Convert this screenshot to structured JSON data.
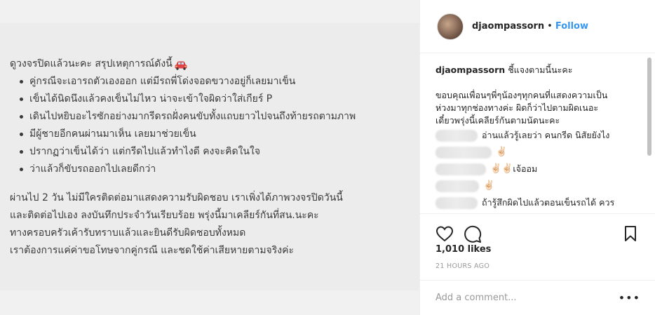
{
  "post_image": {
    "heading": "ดูวงจรปิดแล้วนะคะ สรุปเหตุการณ์ดังนี้",
    "heading_icon": "car-emoji-icon",
    "bullets": [
      "คู่กรณีจะเอารถตัวเองออก แต่มีรถพี่โด่งจอดขวางอยู่ก็เลยมาเข็น",
      "เข็นได้นิดนึงแล้วคงเข็นไม่ไหว น่าจะเข้าใจผิดว่าใส่เกียร์ P",
      "เดินไปหยิบอะไรซักอย่างมากรีดรถฝั่งคนขับทั้งแถบยาวไปจนถึงท้ายรถตามภาพ",
      "มีผู้ชายอีกคนผ่านมาเห็น เลยมาช่วยเข็น",
      "ปรากฏว่าเข็นได้ว่า แต่กรีดไปแล้วทำไงดี คงจะคิดในใจ",
      "ว่าแล้วก็ขับรถออกไปเลยดีกว่า"
    ],
    "paragraph": [
      "ผ่านไป 2 วัน ไม่มีใครติดต่อมาแสดงความรับผิดชอบ เราเพิ่งได้ภาพวงจรปิดวันนี้",
      "และติดต่อไปเอง ลงบันทึกประจำวันเรียบร้อย พรุ่งนี้มาเคลียร์กันที่สน.นะคะ",
      "ทางครอบครัวเค้ารับทราบแล้วและยินดีรับผิดชอบทั้งหมด",
      "เราต้องการแค่ค่าขอโทษจากคู่กรณี และชดใช้ค่าเสียหายตามจริงค่ะ"
    ]
  },
  "header": {
    "username": "djaompassorn",
    "separator": "•",
    "follow_label": "Follow"
  },
  "caption": {
    "username": "djaompassorn",
    "first_line": "ชี้แจงตามนี้นะคะ",
    "body_lines": [
      "ขอบคุณเพื่อนๆพี่ๆน้องๆทุกคนที่แสดงความเป็น",
      "ห่วงมาทุกช่องทางค่ะ ผิดก็ว่าไปตามผิดเนอะ",
      "เดี๋ยวพรุ่งนี้เคลียร์กันตามนัดนะคะ"
    ]
  },
  "comments": [
    {
      "text": "อ่านแล้วรู้เลยว่า คนกรีด นิสัยยังไง",
      "emoji": ""
    },
    {
      "text": "",
      "emoji": "✌🏻"
    },
    {
      "text": "เจ้ออม",
      "emoji": "✌🏻✌🏻"
    },
    {
      "text": "",
      "emoji": "✌🏻"
    },
    {
      "text": "ถ้ารู้สึกผิดไปแล้วตอนเข็นรถได้ ควร",
      "emoji": ""
    }
  ],
  "actions": {
    "like_icon": "heart-icon",
    "comment_icon": "comment-bubble-icon",
    "save_icon": "bookmark-icon"
  },
  "likes": "1,010 likes",
  "time": "21 HOURS AGO",
  "add_comment": {
    "placeholder": "Add a comment...",
    "more_label": "•••"
  },
  "colors": {
    "accent": "#3897f0",
    "text": "#262626",
    "muted": "#999999"
  }
}
